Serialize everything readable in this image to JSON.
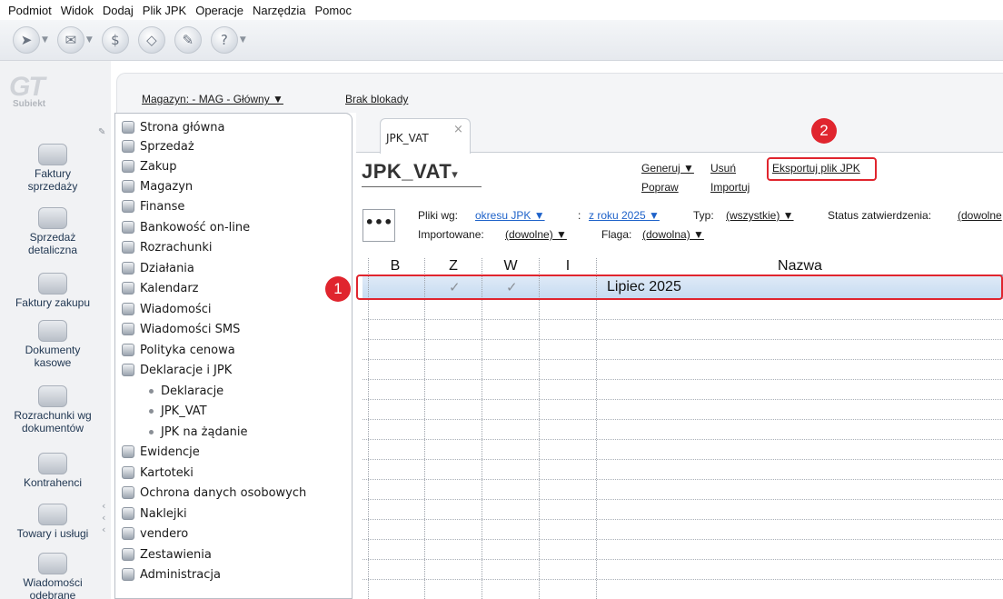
{
  "menu": [
    "Podmiot",
    "Widok",
    "Dodaj",
    "Plik JPK",
    "Operacje",
    "Narzędzia",
    "Pomoc"
  ],
  "toolbar": {
    "icons": [
      "send-icon",
      "mail-icon",
      "money-icon",
      "tag-icon",
      "tools-icon",
      "help-icon"
    ]
  },
  "logo": {
    "big": "GT",
    "small": "Subiekt"
  },
  "leftbar": {
    "items": [
      {
        "label1": "Faktury",
        "label2": "sprzedaży"
      },
      {
        "label1": "Sprzedaż",
        "label2": "detaliczna"
      },
      {
        "label1": "Faktury zakupu",
        "label2": ""
      },
      {
        "label1": "Dokumenty",
        "label2": "kasowe"
      },
      {
        "label1": "Rozrachunki wg",
        "label2": "dokumentów"
      },
      {
        "label1": "Kontrahenci",
        "label2": ""
      },
      {
        "label1": "Towary i usługi",
        "label2": ""
      },
      {
        "label1": "Wiadomości",
        "label2": "odebrane"
      }
    ]
  },
  "header": {
    "magazyn": "Magazyn: - MAG - Główny ▼",
    "blokada": "Brak blokady"
  },
  "nav": {
    "items": [
      "Strona główna",
      "Sprzedaż",
      "Zakup",
      "Magazyn",
      "Finanse",
      "Bankowość on-line",
      "Rozrachunki",
      "Działania",
      "Kalendarz",
      "Wiadomości",
      "Wiadomości SMS",
      "Polityka cenowa",
      "Deklaracje i JPK"
    ],
    "subitems": [
      "Deklaracje",
      "JPK_VAT",
      "JPK na żądanie"
    ],
    "items2": [
      "Ewidencje",
      "Kartoteki",
      "Ochrona danych osobowych",
      "Naklejki",
      "vendero",
      "Zestawienia",
      "Administracja"
    ]
  },
  "tab": {
    "label": "JPK_VAT",
    "close": "×"
  },
  "title": {
    "text": "JPK_VAT",
    "dropdown": "▾"
  },
  "actions": {
    "generuj": "Generuj ▼",
    "usun": "Usuń",
    "eksportuj": "Eksportuj plik JPK",
    "popraw": "Popraw",
    "importuj": "Importuj"
  },
  "filters": {
    "dots": "•••",
    "pliki_label": "Pliki wg:",
    "pliki_value": "okresu JPK ▼",
    "colon": ":",
    "rok_value": "z roku 2025 ▼",
    "typ_label": "Typ:",
    "typ_value": "(wszystkie) ▼",
    "status_label": "Status zatwierdzenia:",
    "status_value": "(dowolne",
    "import_label": "Importowane:",
    "import_value": "(dowolne) ▼",
    "flaga_label": "Flaga:",
    "flaga_value": "(dowolna) ▼"
  },
  "table": {
    "columns": [
      "B",
      "Z",
      "W",
      "I",
      "Nazwa"
    ],
    "rows": [
      {
        "B": "",
        "Z": "✓",
        "W": "✓",
        "I": "",
        "Nazwa": "Lipiec 2025"
      }
    ]
  },
  "callouts": {
    "one": "1",
    "two": "2"
  },
  "colors": {
    "accent": "#e0252e",
    "selection": "#c7dbf1",
    "link": "#1e62c9"
  }
}
